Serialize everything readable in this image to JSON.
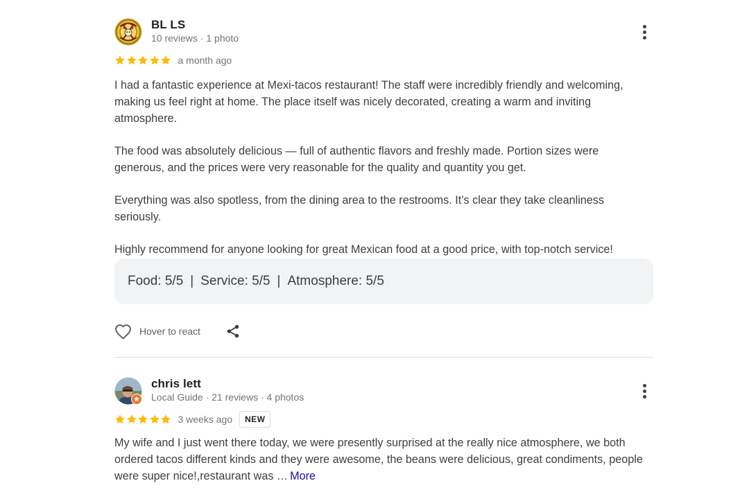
{
  "reviews": [
    {
      "author": "BL LS",
      "meta": "10 reviews · 1 photo",
      "rating": 5,
      "time": "a month ago",
      "paragraphs": [
        "I had a fantastic experience at Mexi-tacos restaurant! The staff were incredibly friendly and welcoming, making us feel right at home. The place itself was nicely decorated, creating a warm and inviting atmosphere.",
        "The food was absolutely delicious — full of authentic flavors and freshly made. Portion sizes were generous, and the prices were very reasonable for the quality and quantity you get.",
        "Everything was also spotless, from the dining area to the restrooms. It’s clear they take cleanliness seriously.",
        "Highly recommend for anyone looking for great Mexican food at a good price, with top-notch service!"
      ],
      "attributes": {
        "food": "Food: 5/5",
        "separator": "|",
        "service": "Service: 5/5",
        "atmosphere": "Atmosphere: 5/5"
      },
      "react_label": "Hover to react"
    },
    {
      "author": "chris lett",
      "meta": "Local Guide · 21 reviews · 4 photos",
      "rating": 5,
      "time": "3 weeks ago",
      "badge": "NEW",
      "text": "My wife and I just went there today, we were presently surprised at the really nice atmosphere, we both ordered tacos different kinds and they were awesome, the beans were delicious, great condiments, people were super nice!,restaurant was …",
      "more_label": "More"
    }
  ],
  "colors": {
    "star": "#fbbc04",
    "link": "#1a0dab",
    "attr_bg": "#f1f3f4",
    "text": "#3c4043",
    "meta": "#70757a"
  },
  "icons": {
    "avatar_1": "band-logo-avatar",
    "avatar_2": "profile-photo-avatar",
    "local_guide": "local-guide-badge-icon",
    "menu": "more-vert-icon",
    "react": "heart-outline-icon",
    "share": "share-icon",
    "star": "star-icon"
  }
}
